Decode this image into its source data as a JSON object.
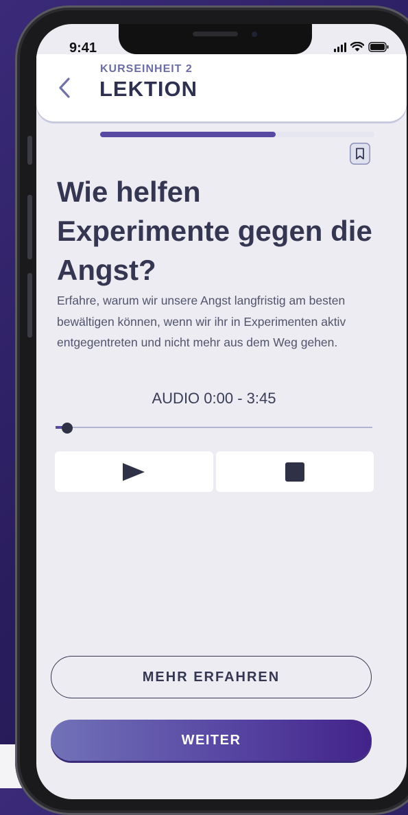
{
  "status": {
    "time": "9:41"
  },
  "header": {
    "eyebrow": "KURSEINHEIT 2",
    "title": "LEKTION",
    "progress": 0.64
  },
  "lesson": {
    "headline": "Wie helfen Experimente gegen die Angst?",
    "description": "Erfahre, warum wir unsere Angst langfristig am besten bewältigen können, wenn wir ihr in Experimenten aktiv entgegentreten und nicht mehr aus dem Weg gehen."
  },
  "audio": {
    "label": "AUDIO 0:00 - 3:45",
    "position": 0.0
  },
  "actions": {
    "more_label": "MEHR ERFAHREN",
    "next_label": "WEITER"
  },
  "icons": [
    "back-chevron-icon",
    "bookmark-icon",
    "play-icon",
    "stop-icon",
    "signal-icon",
    "wifi-icon",
    "battery-icon"
  ],
  "colors": {
    "accent": "#584aa3",
    "text_dark": "#343652",
    "screen_bg": "#ececf2"
  }
}
